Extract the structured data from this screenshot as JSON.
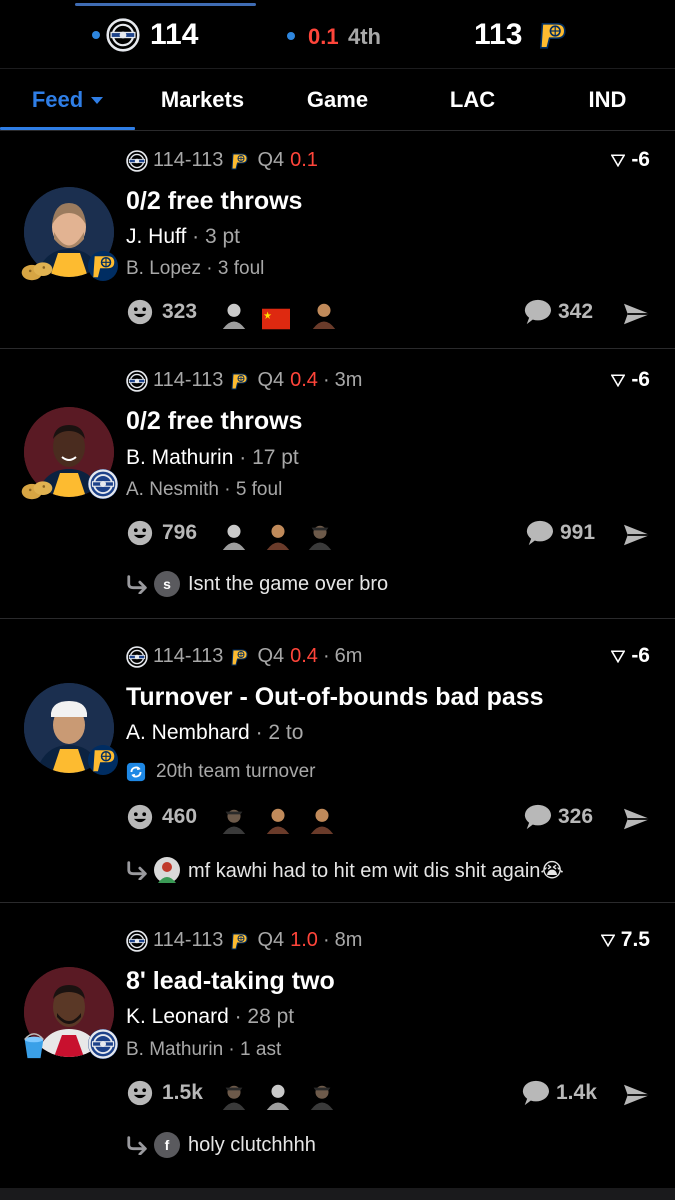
{
  "scoreboard": {
    "home_score": "114",
    "clock_time": "0.1",
    "clock_period": "4th",
    "away_score": "113"
  },
  "tabs": [
    {
      "label": "Feed",
      "active": true
    },
    {
      "label": "Markets",
      "active": false
    },
    {
      "label": "Game",
      "active": false
    },
    {
      "label": "LAC",
      "active": false
    },
    {
      "label": "IND",
      "active": false
    }
  ],
  "feed": [
    {
      "score": "114-113",
      "quarter": "Q4",
      "clock": "0.1",
      "ago": "",
      "line": "-6",
      "headline": "0/2 free throws",
      "player": "J. Huff",
      "player_stat": "3 pt",
      "secondary": "B. Lopez",
      "secondary_stat": "3 foul",
      "reactions": "323",
      "comments": "342",
      "reply_initial": "",
      "reply_text": ""
    },
    {
      "score": "114-113",
      "quarter": "Q4",
      "clock": "0.4",
      "ago": "3m",
      "line": "-6",
      "headline": "0/2 free throws",
      "player": "B. Mathurin",
      "player_stat": "17 pt",
      "secondary": "A. Nesmith",
      "secondary_stat": "5 foul",
      "reactions": "796",
      "comments": "991",
      "reply_initial": "s",
      "reply_text": "Isnt the game over bro"
    },
    {
      "score": "114-113",
      "quarter": "Q4",
      "clock": "0.4",
      "ago": "6m",
      "line": "-6",
      "headline": "Turnover - Out-of-bounds bad pass",
      "player": "A. Nembhard",
      "player_stat": "2 to",
      "secondary": "20th team turnover",
      "secondary_stat": "",
      "reactions": "460",
      "comments": "326",
      "reply_initial": "",
      "reply_text": "mf kawhi had to hit em wit dis shit again😭"
    },
    {
      "score": "114-113",
      "quarter": "Q4",
      "clock": "1.0",
      "ago": "8m",
      "line": "7.5",
      "headline": "8' lead-taking two",
      "player": "K. Leonard",
      "player_stat": "28 pt",
      "secondary": "B. Mathurin",
      "secondary_stat": "1 ast",
      "reactions": "1.5k",
      "comments": "1.4k",
      "reply_initial": "f",
      "reply_text": "holy clutchhhh"
    }
  ],
  "colors": {
    "accent": "#2f7ee6",
    "clock_red": "#ff453a",
    "muted": "#a8a8a8",
    "pacers_gold": "#fdbb30",
    "pacers_navy": "#002d62",
    "clippers_blue": "#1d428a"
  }
}
